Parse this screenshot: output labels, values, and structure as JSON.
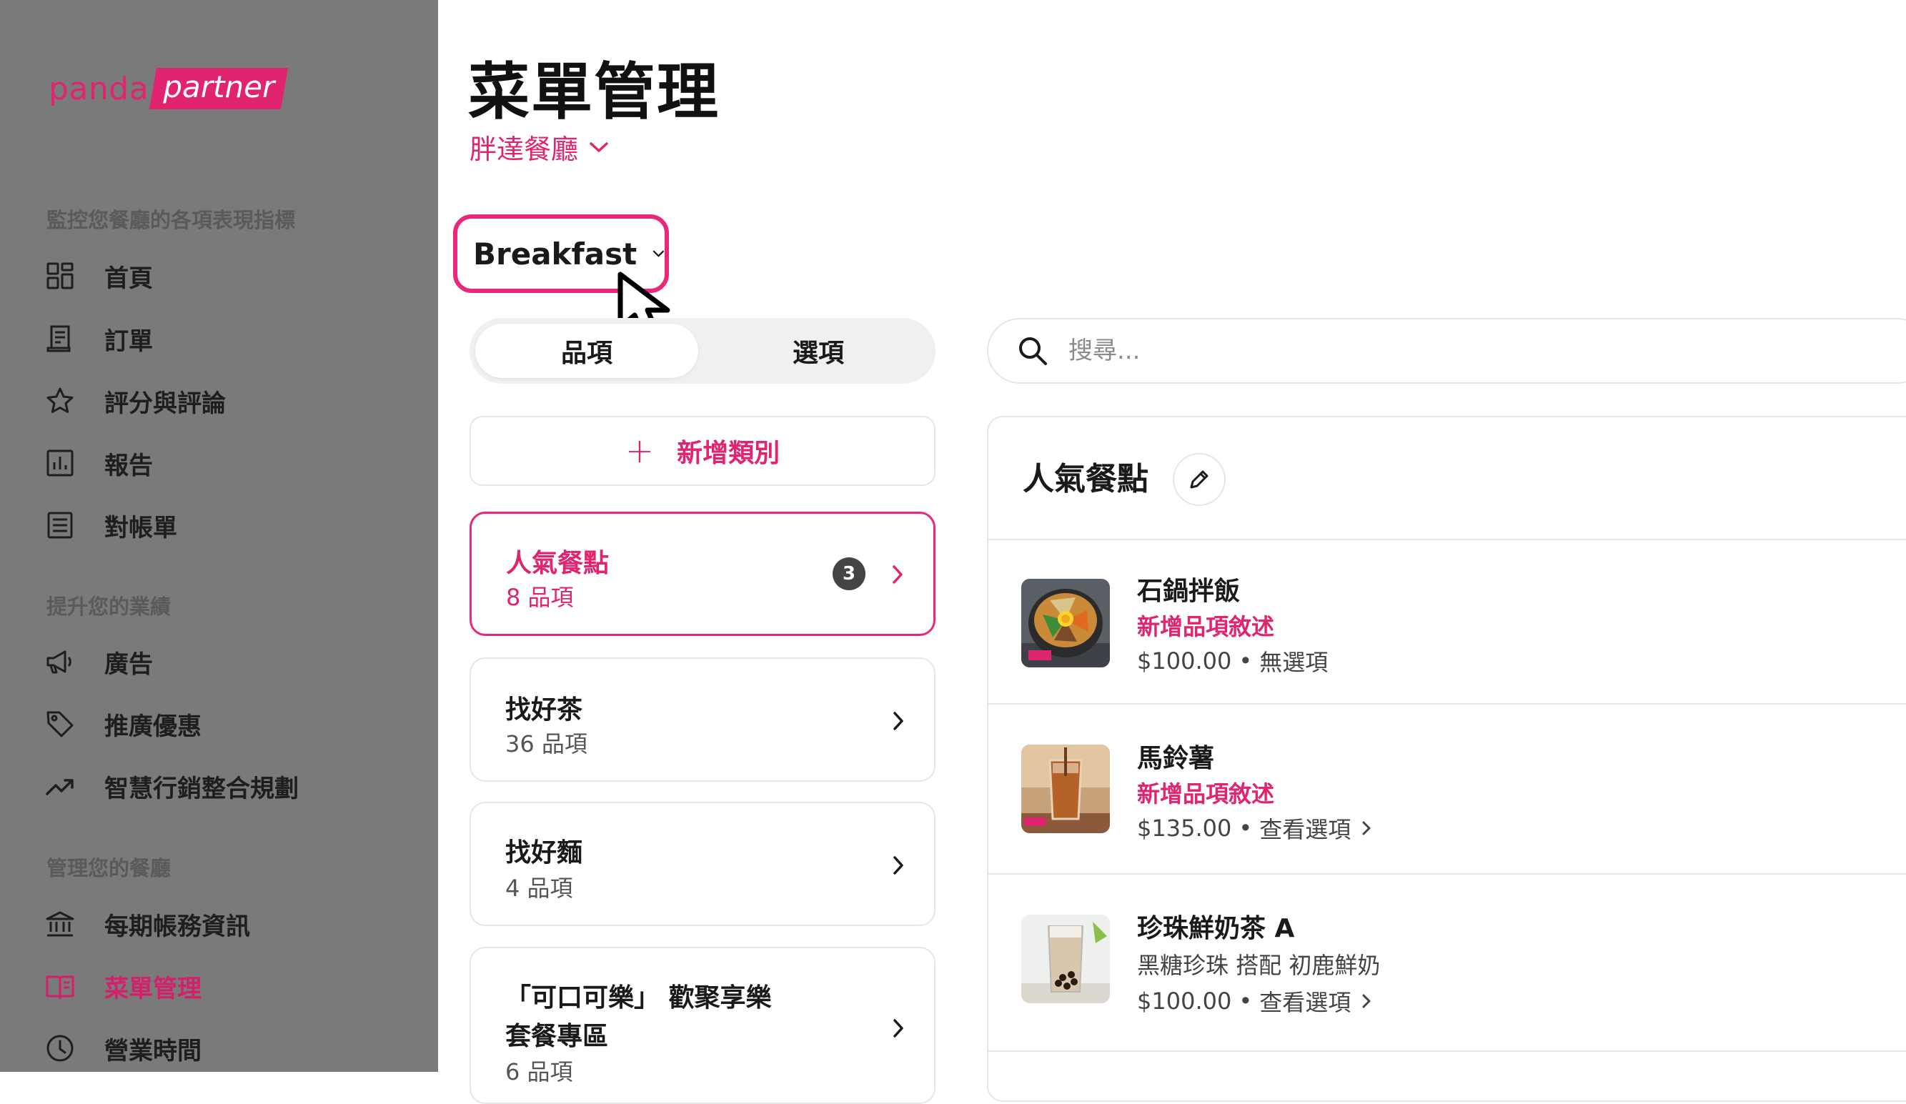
{
  "brand": {
    "panda": "panda",
    "partner": "partner",
    "accent": "#e0246f"
  },
  "sidebar": {
    "sections": [
      {
        "title": "監控您餐廳的各項表現指標"
      },
      {
        "title": "提升您的業績"
      },
      {
        "title": "管理您的餐廳"
      }
    ],
    "items": [
      {
        "label": "首頁",
        "icon": "dashboard-icon"
      },
      {
        "label": "訂單",
        "icon": "receipt-icon"
      },
      {
        "label": "評分與評論",
        "icon": "star-icon"
      },
      {
        "label": "報告",
        "icon": "chart-icon"
      },
      {
        "label": "對帳單",
        "icon": "document-icon"
      },
      {
        "label": "廣告",
        "icon": "megaphone-icon"
      },
      {
        "label": "推廣優惠",
        "icon": "tag-icon"
      },
      {
        "label": "智慧行銷整合規劃",
        "icon": "trend-icon"
      },
      {
        "label": "每期帳務資訊",
        "icon": "bank-icon"
      },
      {
        "label": "菜單管理",
        "icon": "menu-book-icon",
        "active": true
      },
      {
        "label": "營業時間",
        "icon": "clock-icon"
      }
    ]
  },
  "header": {
    "title": "菜單管理",
    "restaurant": "胖達餐廳"
  },
  "menu_select": {
    "value": "Breakfast"
  },
  "tabs": [
    {
      "label": "品項",
      "active": true
    },
    {
      "label": "選項",
      "active": false
    }
  ],
  "search": {
    "placeholder": "搜尋..."
  },
  "add_category": {
    "label": "新增類別"
  },
  "categories": [
    {
      "name": "人氣餐點",
      "count": "8 品項",
      "badge": "3",
      "active": true
    },
    {
      "name": "找好茶",
      "count": "36 品項"
    },
    {
      "name": "找好麵",
      "count": "4 品項"
    },
    {
      "name_line1": "「可口可樂」 歡聚享樂",
      "name_line2": "套餐專區",
      "count": "6 品項"
    }
  ],
  "panel": {
    "title": "人氣餐點",
    "items": [
      {
        "name": "石鍋拌飯",
        "desc": "新增品項敘述",
        "price": "$100.00",
        "options": "無選項"
      },
      {
        "name": "馬鈴薯",
        "desc": "新增品項敘述",
        "price": "$135.00",
        "options": "查看選項"
      },
      {
        "name": "珍珠鮮奶茶 A",
        "desc": "黑糖珍珠 搭配 初鹿鮮奶",
        "price": "$100.00",
        "options": "查看選項"
      }
    ]
  }
}
